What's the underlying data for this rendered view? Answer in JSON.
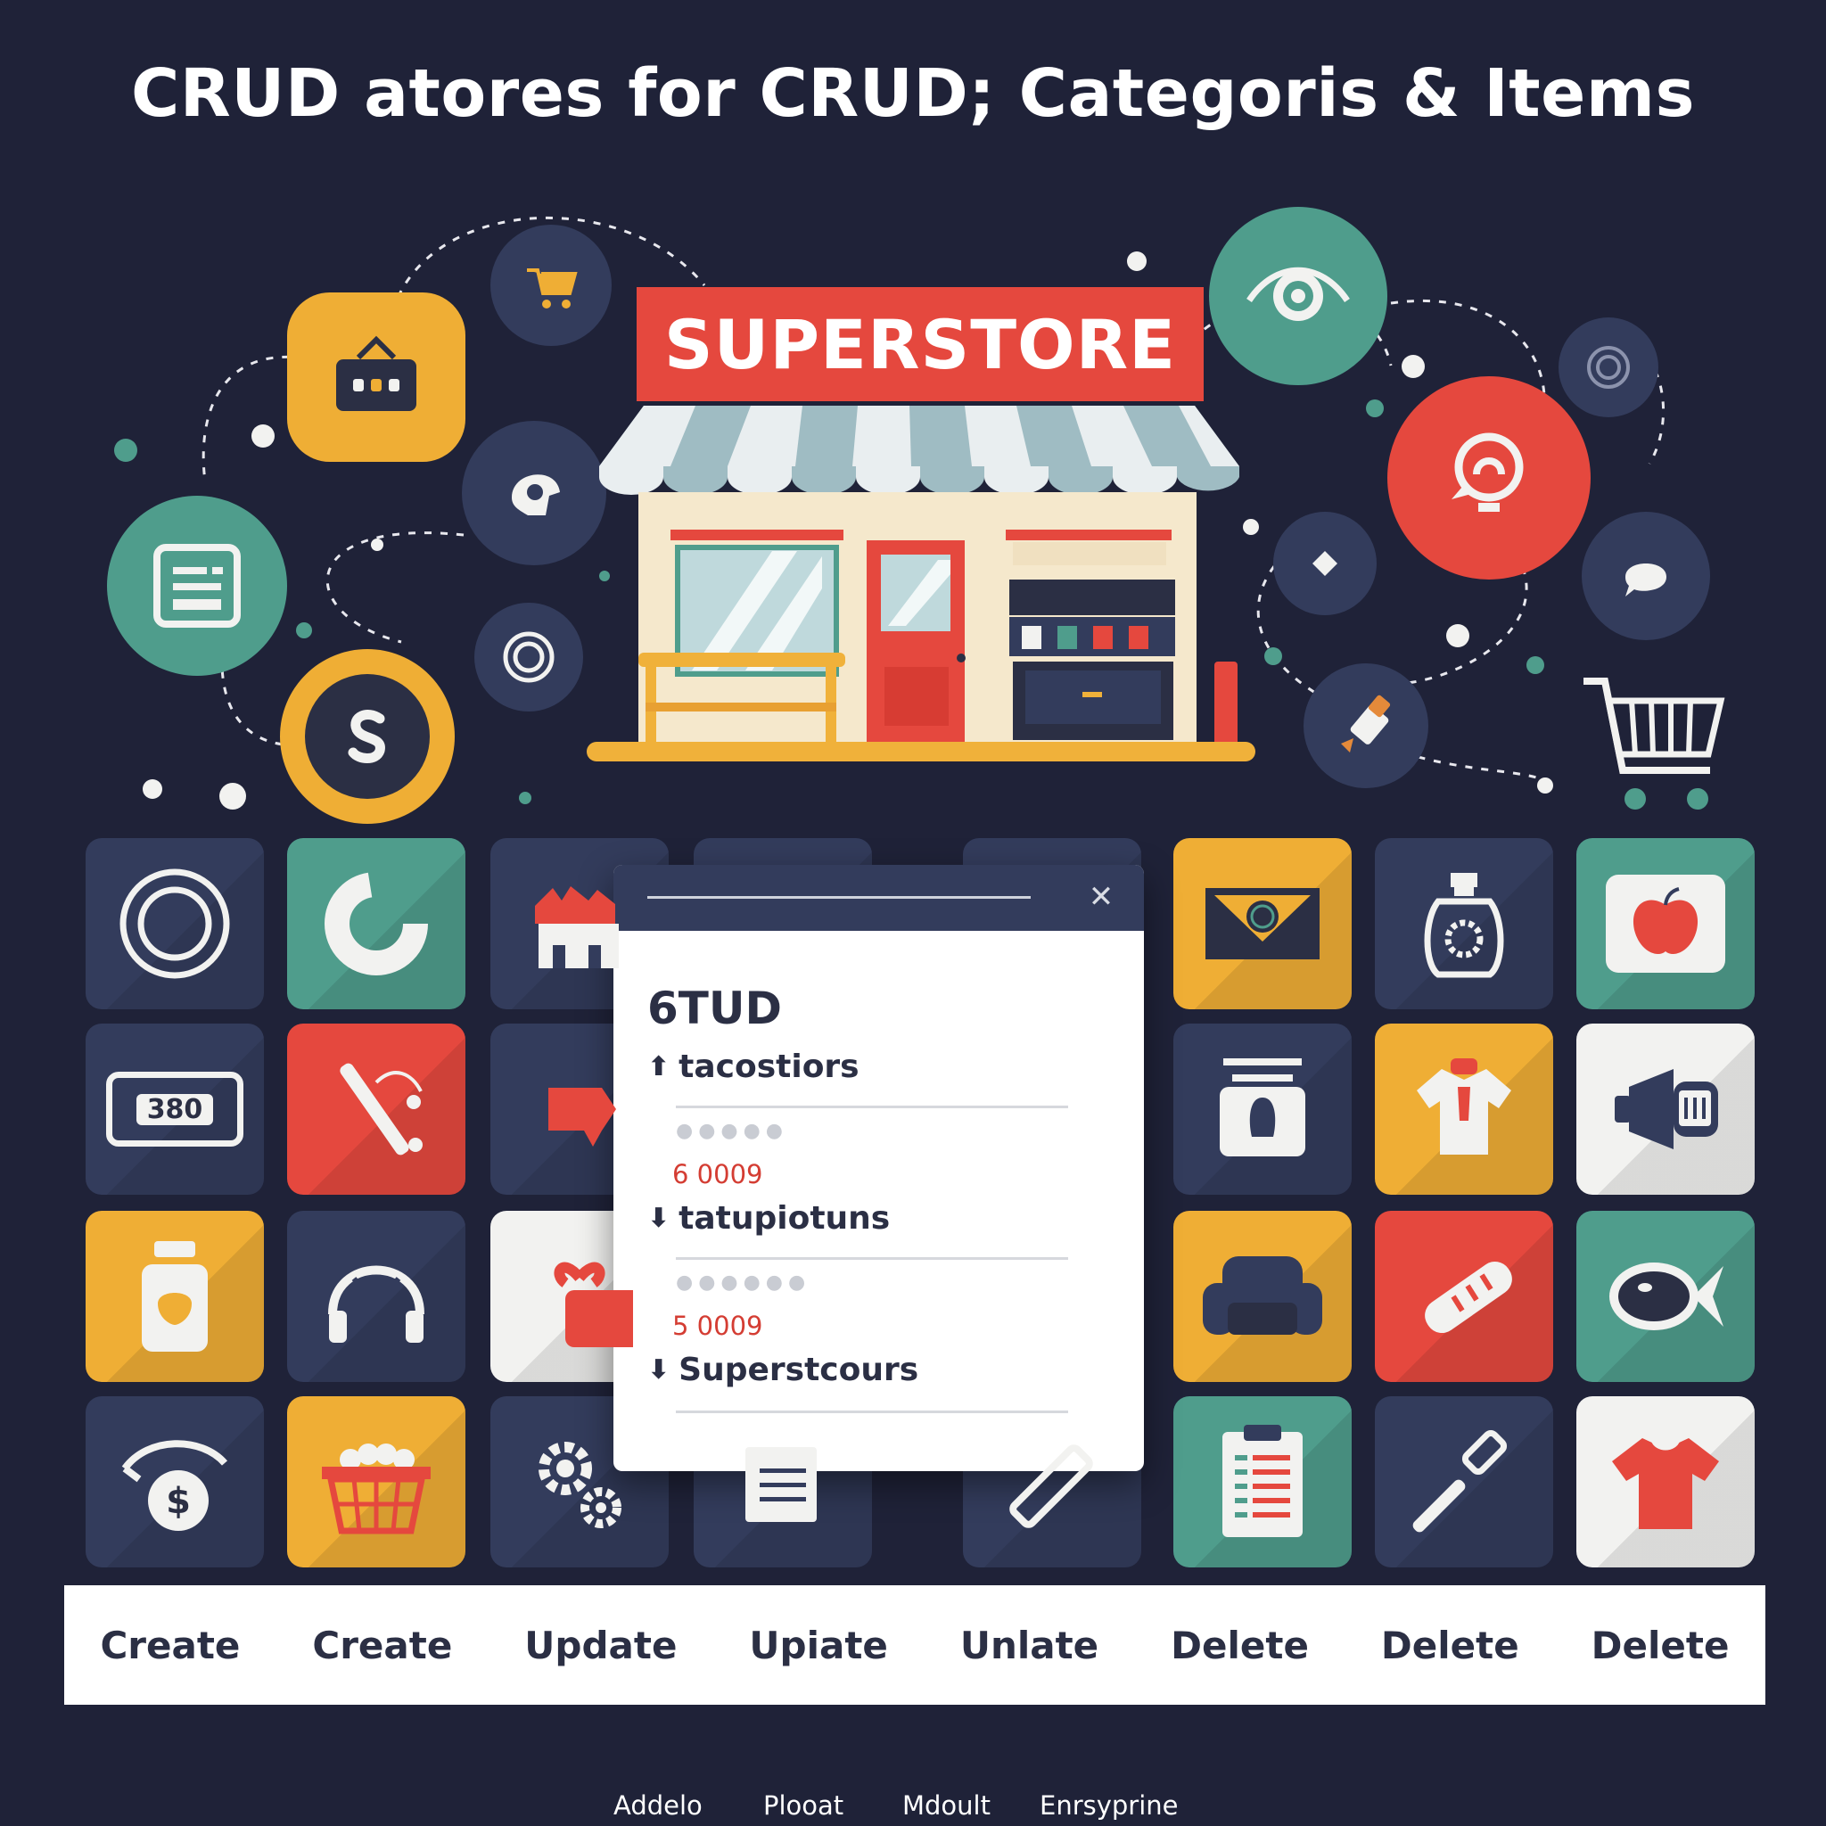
{
  "title": "CRUD atores for  CRUD; Categoris & Items",
  "store": {
    "sign": "SUPERSTORE"
  },
  "tiles": {
    "price_display": "380"
  },
  "dialog": {
    "heading": "6TUD",
    "rows": [
      {
        "label": "tacostiors",
        "arrow": "⬆"
      },
      {
        "label": "tatupiotuns",
        "arrow": "⬇"
      },
      {
        "label": "Superstcours",
        "arrow": "⬇"
      }
    ],
    "prices": [
      "6 0009",
      "5 0009"
    ],
    "close_glyph": "✕"
  },
  "actions": [
    "Create",
    "Create",
    "Update",
    "Upiate",
    "Unlate",
    "Delete",
    "Delete",
    "Delete"
  ],
  "footer": [
    "Addelo",
    "Plooat",
    "Mdoult",
    "Enrsyprine"
  ],
  "colors": {
    "background": "#1f2238",
    "navy": "#333c5c",
    "teal": "#4f9d8c",
    "red": "#e5483e",
    "yellow": "#efae35",
    "white": "#f2f2f0"
  }
}
